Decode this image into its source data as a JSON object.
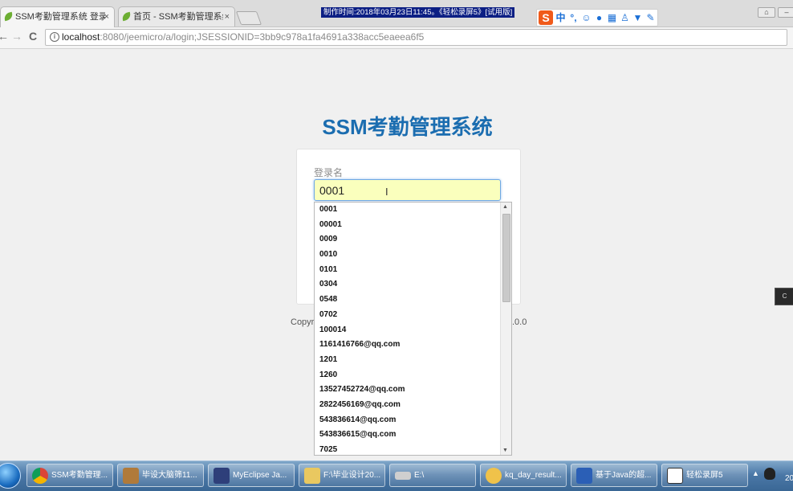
{
  "tabs": [
    {
      "title": "SSM考勤管理系统 登录",
      "close": "×",
      "active": true
    },
    {
      "title": "首页 - SSM考勤管理系统",
      "close": "×",
      "active": false
    }
  ],
  "recording_banner": "制作时间:2018年03月23日11:45。《轻松录屏5》[试用版]",
  "ime": {
    "logo": "S",
    "mode": "中",
    "punct": "°,"
  },
  "nav": {
    "back": "←",
    "forward": "→",
    "reload": "C"
  },
  "address": {
    "host": "localhost",
    "path": ":8080/jeemicro/a/login;JSESSIONID=3bb9c978a1fa4691a338acc5eaeea6f5"
  },
  "page": {
    "title": "SSM考勤管理系统",
    "username_label": "登录名",
    "username_value": "0001",
    "copyright_left": "Copyri",
    "copyright_right": ".0.0"
  },
  "autocomplete": [
    "0001",
    "00001",
    "0009",
    "0010",
    "0101",
    "0304",
    "0548",
    "0702",
    "100014",
    "1161416766@qq.com",
    "1201",
    "1260",
    "13527452724@qq.com",
    "2822456169@qq.com",
    "543836614@qq.com",
    "543836615@qq.com",
    "7025"
  ],
  "side_widget": "C",
  "taskbar": [
    {
      "label": "SSM考勤管理...",
      "icon_color": "#e8b64a"
    },
    {
      "label": "毕设大脑筛11...",
      "icon_color": "#b07a3a"
    },
    {
      "label": "MyEclipse Ja...",
      "icon_color": "#2e3f7a"
    },
    {
      "label": "F:\\毕业设计20...",
      "icon_color": "#e9c860"
    },
    {
      "label": "E:\\",
      "icon_color": "#cfcfcf"
    },
    {
      "label": "kq_day_result...",
      "icon_color": "#f0c24a"
    },
    {
      "label": "基于Java的超...",
      "icon_color": "#2b5fb6"
    },
    {
      "label": "轻松录屏5",
      "icon_color": "#ffffff"
    }
  ],
  "tray": {
    "clock": "20"
  }
}
